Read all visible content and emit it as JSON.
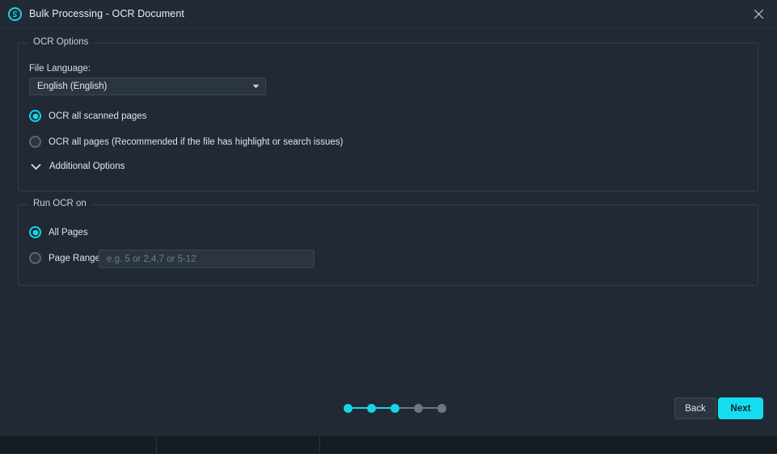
{
  "window": {
    "title": "Bulk Processing - OCR Document",
    "app_icon": "app-logo-icon",
    "close_icon": "close-icon"
  },
  "colors": {
    "accent": "#16d6e6",
    "next_button": "#16dcf0",
    "background": "#212934",
    "titlebar": "#222a35",
    "panel_border": "#333d4b",
    "field_background": "#2b3542",
    "inactive_step": "#6c7787"
  },
  "ocr_options": {
    "legend": "OCR Options",
    "file_language": {
      "label": "File Language:",
      "value": "English (English)",
      "arrow_icon": "chevron-down-icon"
    },
    "radios": [
      {
        "label": "OCR all scanned pages",
        "selected": true
      },
      {
        "label": "OCR all pages (Recommended if the file has highlight or search issues)",
        "selected": false
      }
    ],
    "additional_options": {
      "label": "Additional Options",
      "icon": "chevron-down-icon",
      "expanded": false
    }
  },
  "run_ocr_on": {
    "legend": "Run OCR on",
    "radios": [
      {
        "label": "All Pages",
        "selected": true
      },
      {
        "label": "Page Range",
        "selected": false
      }
    ],
    "page_range_input": {
      "value": "",
      "placeholder": "e.g. 5 or 2,4,7 or 5-12"
    }
  },
  "footer": {
    "stepper": {
      "total": 5,
      "current": 3,
      "dots": [
        true,
        true,
        true,
        false,
        false
      ]
    },
    "back_label": "Back",
    "next_label": "Next"
  }
}
